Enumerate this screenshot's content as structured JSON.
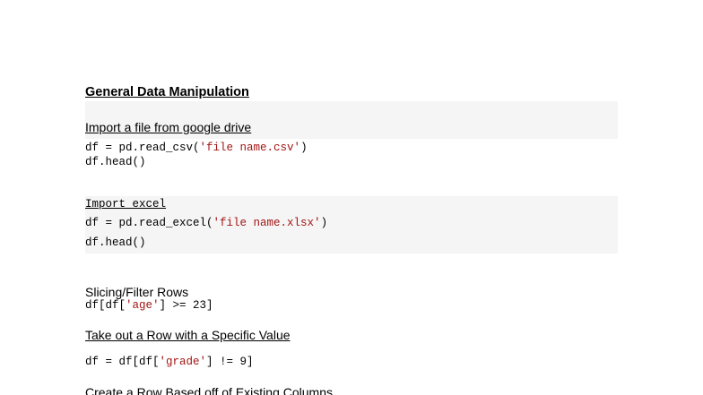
{
  "heading": "General Data Manipulation",
  "sections": {
    "import_drive": {
      "title": "Import a file from google drive",
      "code_line1_prefix": "df = pd.read_csv(",
      "code_line1_string": "'file name.csv'",
      "code_line1_suffix": ")",
      "code_line2": "df.head()"
    },
    "import_excel": {
      "title": "Import excel",
      "code_line1_prefix": "df = pd.read_excel(",
      "code_line1_string": "'file name.xlsx'",
      "code_line1_suffix": ")",
      "code_line2": "df.head()"
    },
    "slicing": {
      "title": "Slicing/Filter Rows",
      "code_prefix": "df[df[",
      "code_string": "'age'",
      "code_suffix": "] >= 23]"
    },
    "remove_row": {
      "title": "Take out a Row with a Specific Value",
      "code_prefix": "df = df[df[",
      "code_string": "'grade'",
      "code_suffix": "] != 9]"
    },
    "create_row": {
      "title": "Create a Row Based off of Existing Columns"
    }
  },
  "colors": {
    "string": "#a31515",
    "code_background": "#f5f5f5",
    "text": "#000000"
  }
}
